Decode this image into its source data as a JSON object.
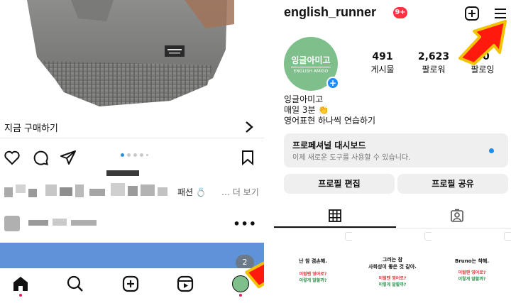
{
  "left": {
    "shop_label": "지금 구매하기",
    "caption_tail": "패션 💍",
    "caption_more": "… 더 보기",
    "media_count_badge": "2",
    "carousel_total": 5,
    "carousel_active": 1
  },
  "right": {
    "username": "english_runner",
    "notif_badge": "9+",
    "avatar_text": "잉글아미고",
    "avatar_sub": "ENGLISH AMIGO",
    "stats": [
      {
        "num": "491",
        "label": "게시물"
      },
      {
        "num": "2,623",
        "label": "팔로워"
      },
      {
        "num": "70",
        "label": "팔로잉"
      }
    ],
    "bio": [
      "잉글아미고",
      "매일 3분 👏",
      "영어표현 하나씩 연습하기"
    ],
    "pro_title": "프로페셔널 대시보드",
    "pro_sub": "이제 새로운 도구를 사용할 수 있습니다.",
    "btn_edit": "프로필 편집",
    "btn_share": "프로필 공유",
    "posts": [
      {
        "line1": "난 참 겸손해.",
        "red": "이럴땐 영어로?",
        "green": "이렇게 말할까?"
      },
      {
        "line1": "그러는 참",
        "line2": "사회성이 좋은 것 같아.",
        "red": "이럴땐 영어로?",
        "green": "이렇게 말할까?"
      },
      {
        "line1": "Bruno는 착해.",
        "red": "이럴땐 영어로?",
        "green": "이렇게 말할까?"
      }
    ]
  },
  "colors": {
    "accent": "#1a8cff",
    "badge": "#ff3040",
    "arrow_fill": "#ff1a0d",
    "arrow_stroke": "#f3c200"
  }
}
